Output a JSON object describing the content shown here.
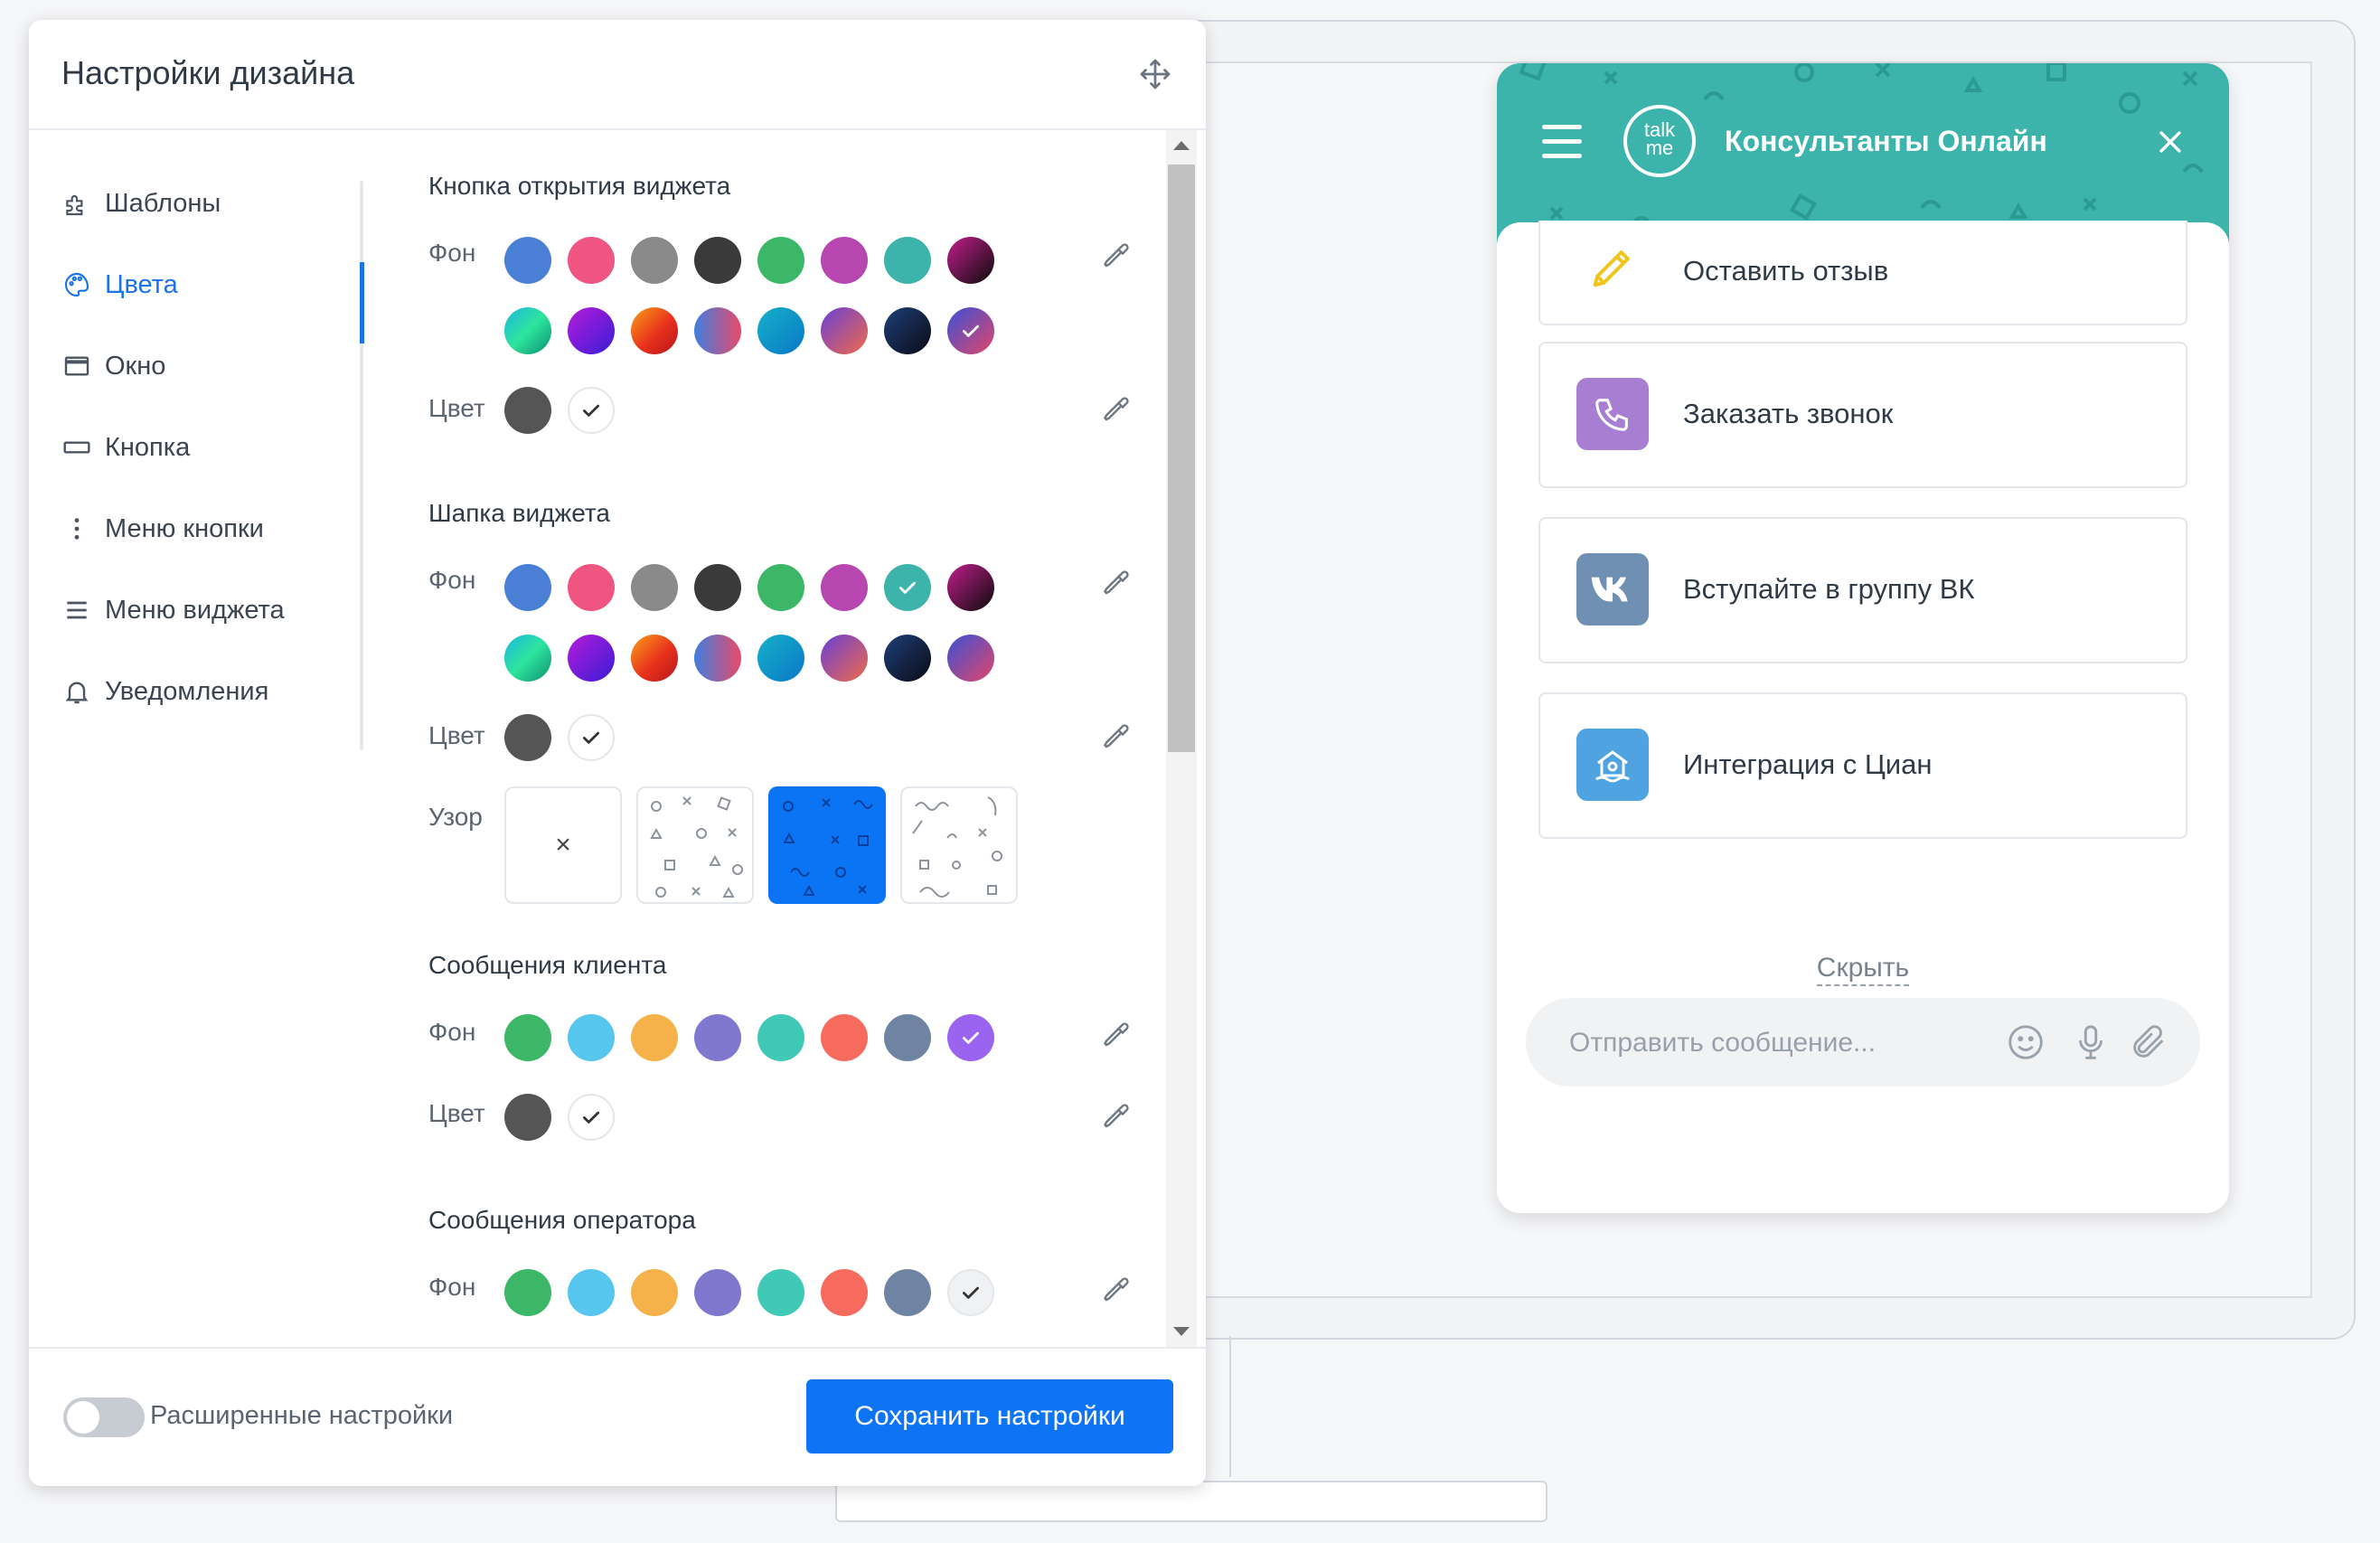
{
  "panel": {
    "title": "Настройки дизайна",
    "nav": [
      {
        "label": "Шаблоны",
        "icon": "puzzle-icon"
      },
      {
        "label": "Цвета",
        "icon": "palette-icon",
        "active": true
      },
      {
        "label": "Окно",
        "icon": "window-icon"
      },
      {
        "label": "Кнопка",
        "icon": "button-icon"
      },
      {
        "label": "Меню кнопки",
        "icon": "vertical-dots-icon"
      },
      {
        "label": "Меню виджета",
        "icon": "list-icon"
      },
      {
        "label": "Уведомления",
        "icon": "bell-icon"
      }
    ],
    "labels": {
      "bg": "Фон",
      "color": "Цвет",
      "pattern": "Узор"
    },
    "sections": {
      "open_button": "Кнопка открытия виджета",
      "header": "Шапка виджета",
      "client_messages": "Сообщения клиента",
      "operator_messages": "Сообщения оператора"
    },
    "pattern_none_symbol": "×",
    "footer": {
      "advanced_label": "Расширенные настройки",
      "advanced_enabled": false,
      "save_label": "Сохранить настройки"
    },
    "accent_color": "#0d74f5"
  },
  "widget": {
    "title": "Консультанты Онлайн",
    "logo_text_top": "talk",
    "logo_text_bottom": "me",
    "header_color": "#3cb4ac",
    "items": [
      {
        "label": "Оставить отзыв",
        "icon": "pencil-icon"
      },
      {
        "label": "Заказать звонок",
        "icon": "phone-icon",
        "color": "#a77ed1"
      },
      {
        "label": "Вступайте в группу ВК",
        "icon": "vk-icon",
        "color": "#6f8fb3"
      },
      {
        "label": "Интеграция с Циан",
        "icon": "house-icon",
        "color": "#4ea3e0"
      }
    ],
    "hide_label": "Скрыть",
    "input_placeholder": "Отправить сообщение..."
  }
}
